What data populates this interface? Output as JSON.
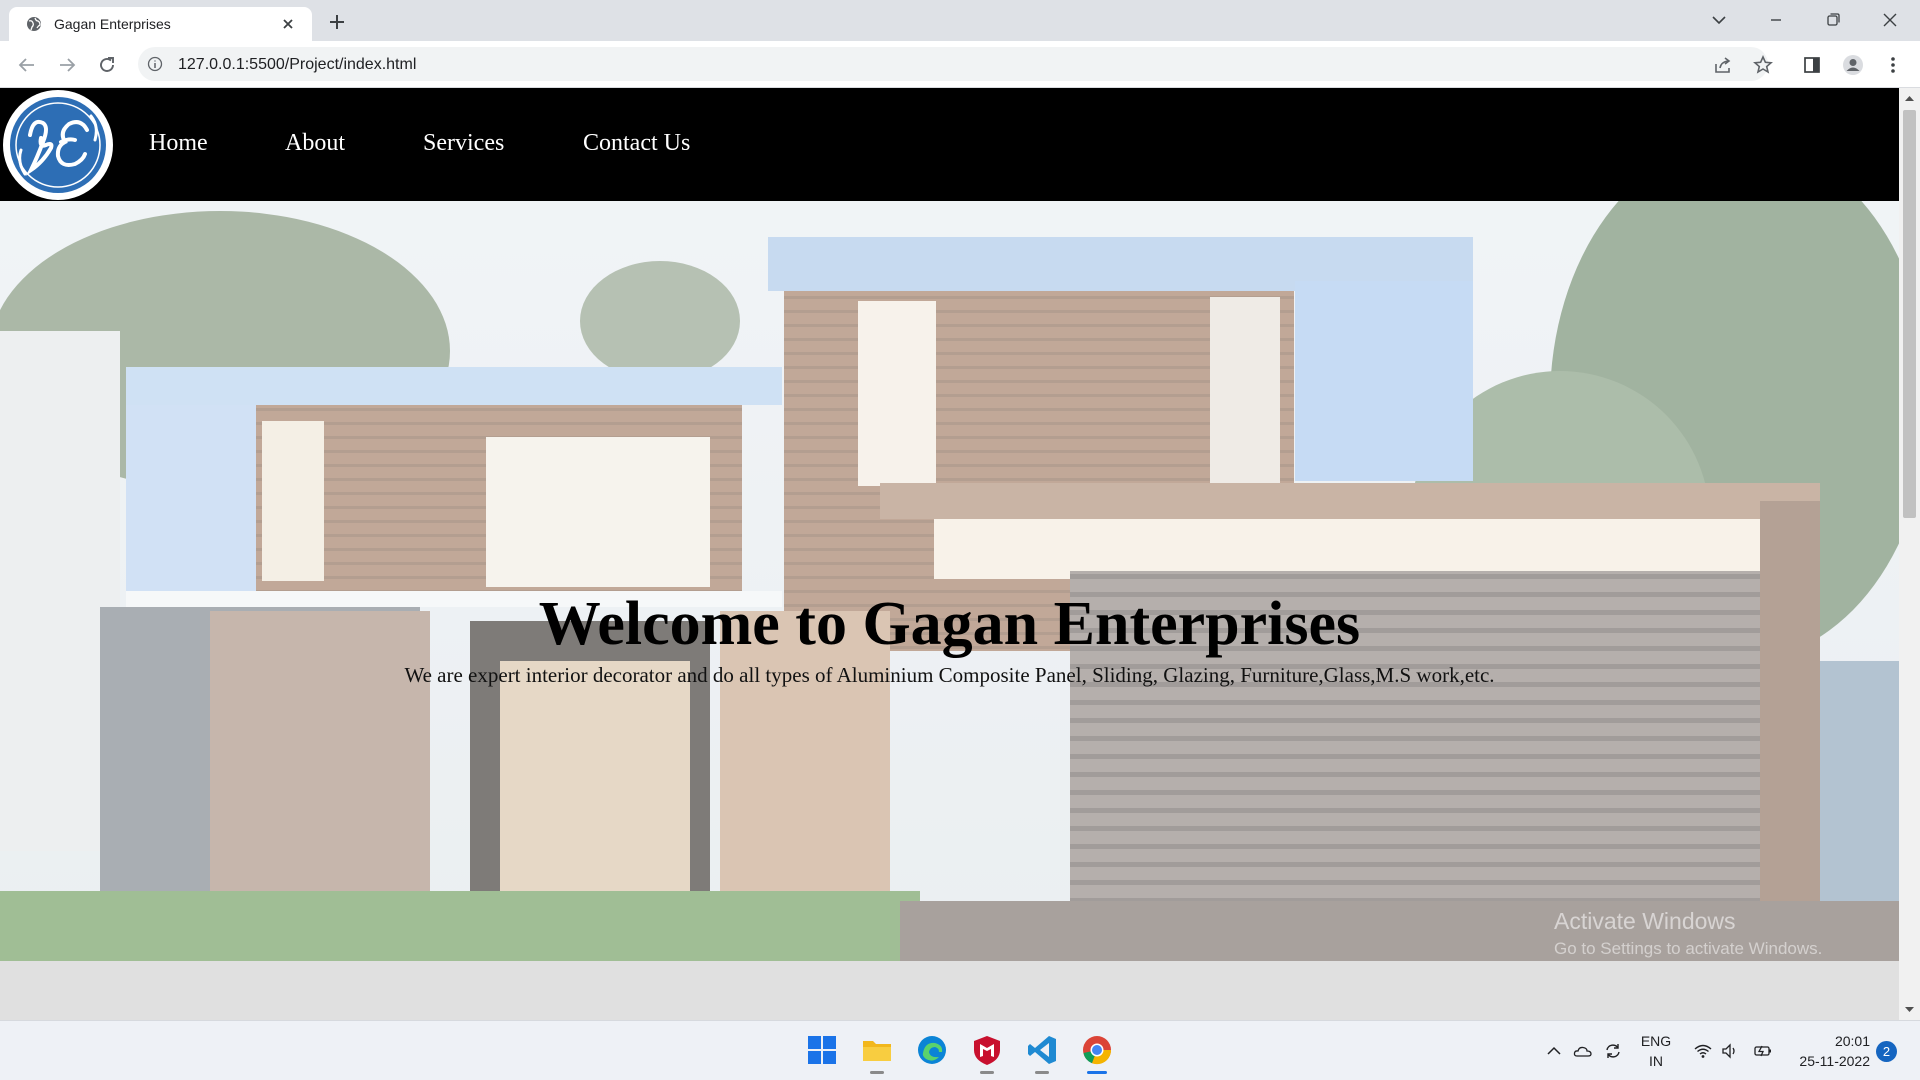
{
  "browser": {
    "tab_title": "Gagan Enterprises",
    "url": "127.0.0.1:5500/Project/index.html"
  },
  "site": {
    "nav": [
      {
        "label": "Home"
      },
      {
        "label": "About"
      },
      {
        "label": "Services"
      },
      {
        "label": "Contact Us"
      }
    ],
    "logo_icon": "ge-monogram-logo",
    "hero": {
      "title": "Welcome to Gagan Enterprises",
      "subtitle": "We are expert interior decorator and do all types of Aluminium Composite Panel, Sliding, Glazing, Furniture,Glass,M.S work,etc."
    }
  },
  "watermark": {
    "title": "Activate Windows",
    "subtitle": "Go to Settings to activate Windows."
  },
  "taskbar": {
    "apps": [
      "windows-start-icon",
      "file-explorer-icon",
      "edge-icon",
      "mcafee-icon",
      "vscode-icon",
      "chrome-icon"
    ],
    "language_line1": "ENG",
    "language_line2": "IN",
    "time": "20:01",
    "date": "25-11-2022",
    "notification_count": "2"
  },
  "colors": {
    "nav_background": "#000000",
    "logo_blue": "#2d6eb5",
    "tabstrip": "#dee1e6",
    "taskbar": "#eef1f6"
  }
}
